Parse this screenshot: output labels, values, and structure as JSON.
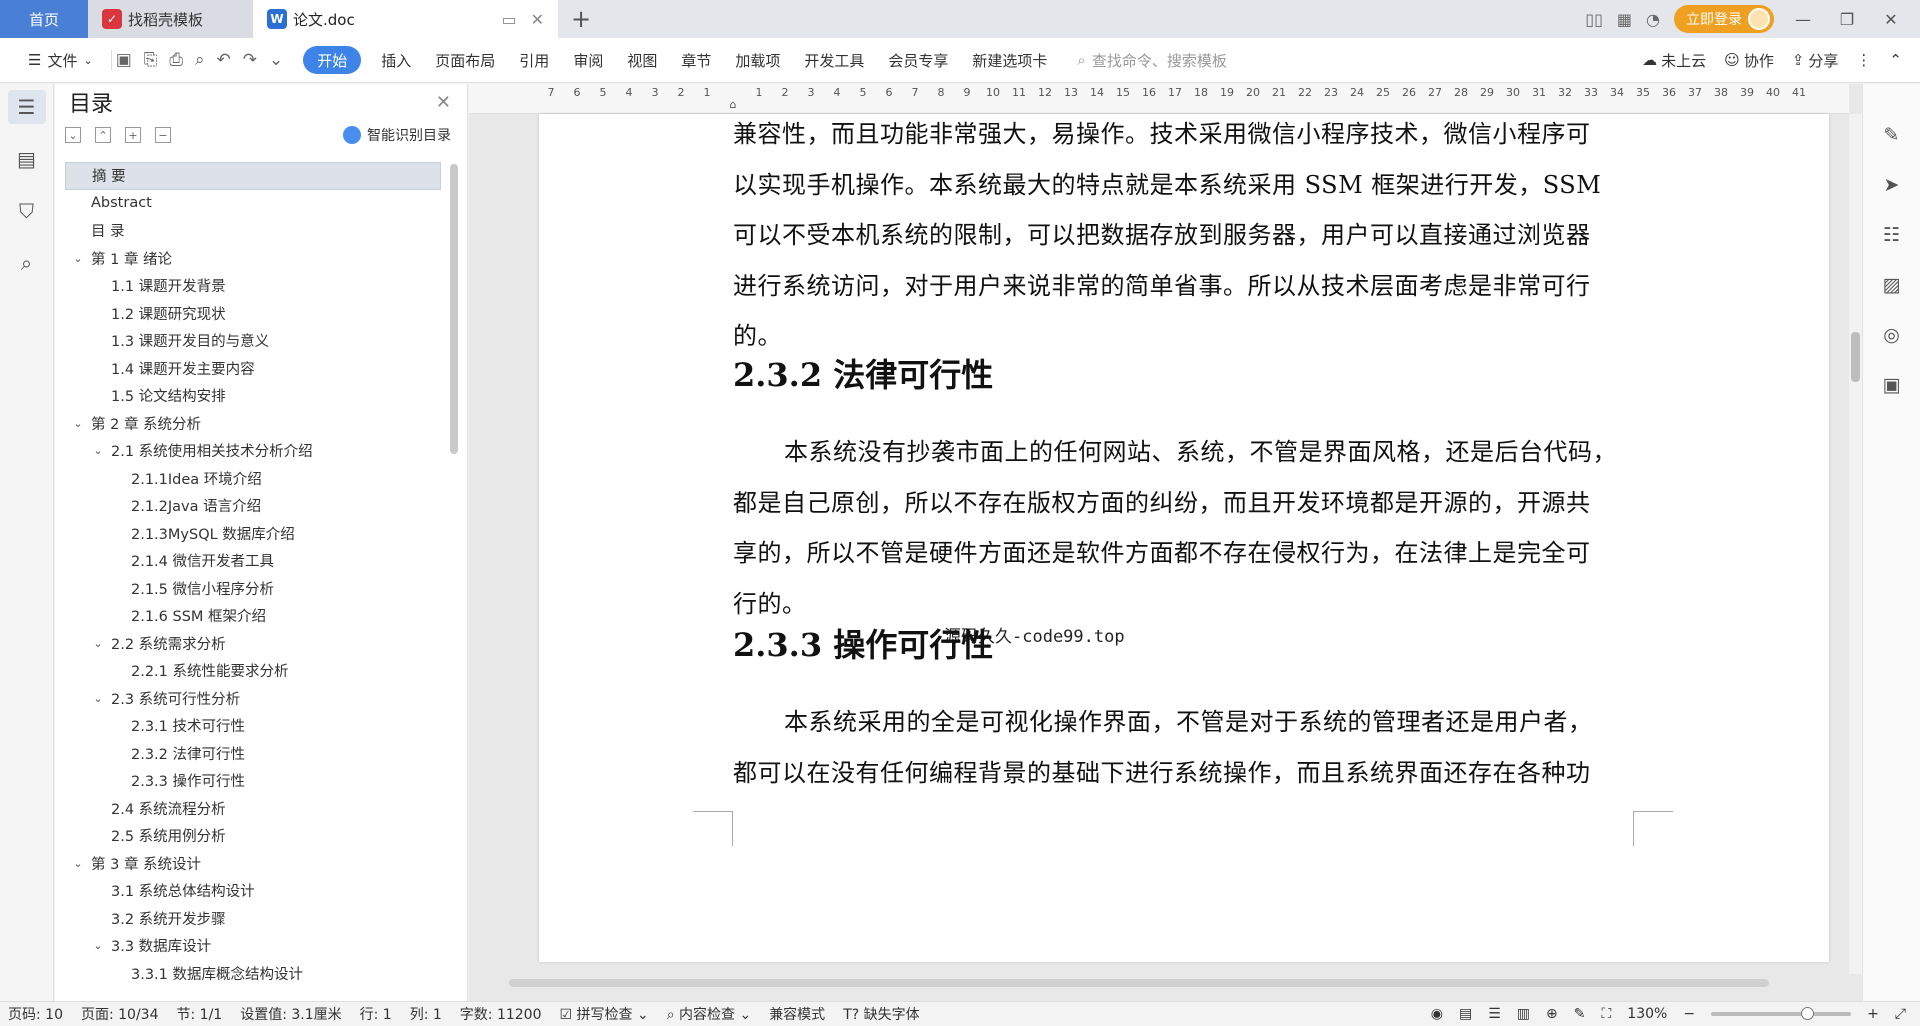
{
  "titlebar": {
    "home_tab": "首页",
    "template_tab": "找稻壳模板",
    "doc_tab": "论文.doc",
    "login": "立即登录"
  },
  "toolbar": {
    "file": "文件",
    "menus": [
      "开始",
      "插入",
      "页面布局",
      "引用",
      "审阅",
      "视图",
      "章节",
      "加载项",
      "开发工具",
      "会员专享",
      "新建选项卡"
    ],
    "search_placeholder": "查找命令、搜索模板",
    "cloud": "未上云",
    "collab": "协作",
    "share": "分享"
  },
  "toc": {
    "title": "目录",
    "smart": "智能识别目录",
    "items": [
      {
        "text": "摘  要",
        "level": 0,
        "selected": true
      },
      {
        "text": "Abstract",
        "level": 0
      },
      {
        "text": "目  录",
        "level": 0
      },
      {
        "text": "第 1 章   绪论",
        "level": 0,
        "collapsible": true
      },
      {
        "text": "1.1 课题开发背景",
        "level": 1
      },
      {
        "text": "1.2 课题研究现状",
        "level": 1
      },
      {
        "text": "1.3 课题开发目的与意义",
        "level": 1
      },
      {
        "text": "1.4 课题开发主要内容",
        "level": 1
      },
      {
        "text": "1.5 论文结构安排",
        "level": 1
      },
      {
        "text": "第 2 章  系统分析",
        "level": 0,
        "collapsible": true
      },
      {
        "text": "2.1 系统使用相关技术分析介绍",
        "level": 1,
        "collapsible": true
      },
      {
        "text": "2.1.1Idea 环境介绍",
        "level": 2
      },
      {
        "text": "2.1.2Java 语言介绍",
        "level": 2
      },
      {
        "text": "2.1.3MySQL 数据库介绍",
        "level": 2
      },
      {
        "text": "2.1.4 微信开发者工具",
        "level": 2
      },
      {
        "text": "2.1.5 微信小程序分析",
        "level": 2
      },
      {
        "text": "2.1.6 SSM 框架介绍",
        "level": 2
      },
      {
        "text": "2.2 系统需求分析",
        "level": 1,
        "collapsible": true
      },
      {
        "text": "2.2.1 系统性能要求分析",
        "level": 2
      },
      {
        "text": "2.3 系统可行性分析",
        "level": 1,
        "collapsible": true
      },
      {
        "text": "2.3.1 技术可行性",
        "level": 2
      },
      {
        "text": "2.3.2 法律可行性",
        "level": 2
      },
      {
        "text": "2.3.3 操作可行性",
        "level": 2
      },
      {
        "text": "2.4 系统流程分析",
        "level": 1
      },
      {
        "text": "2.5 系统用例分析",
        "level": 1
      },
      {
        "text": "第 3 章  系统设计",
        "level": 0,
        "collapsible": true
      },
      {
        "text": "3.1 系统总体结构设计",
        "level": 1
      },
      {
        "text": "3.2 系统开发步骤",
        "level": 1
      },
      {
        "text": "3.3 数据库设计",
        "level": 1,
        "collapsible": true
      },
      {
        "text": "3.3.1 数据库概念结构设计",
        "level": 2
      }
    ]
  },
  "ruler": {
    "left_numbers": [
      "7",
      "6",
      "5",
      "4",
      "3",
      "2",
      "1"
    ],
    "right_numbers": [
      "1",
      "2",
      "3",
      "4",
      "5",
      "6",
      "7",
      "8",
      "9",
      "10",
      "11",
      "12",
      "13",
      "14",
      "15",
      "16",
      "17",
      "18",
      "19",
      "20",
      "21",
      "22",
      "23",
      "24",
      "25",
      "26",
      "27",
      "28",
      "29",
      "30",
      "31",
      "32",
      "33",
      "34",
      "35",
      "36",
      "37",
      "38",
      "39",
      "40",
      "41"
    ]
  },
  "document": {
    "para1": [
      "兼容性，而且功能非常强大，易操作。技术采用微信小程序技术，微信小程序可",
      "以实现手机操作。本系统最大的特点就是本系统采用 SSM 框架进行开发，SSM",
      "可以不受本机系统的限制，可以把数据存放到服务器，用户可以直接通过浏览器",
      "进行系统访问，对于用户来说非常的简单省事。所以从技术层面考虑是非常可行",
      "的。"
    ],
    "heading1": "2.3.2 法律可行性",
    "para2": [
      "本系统没有抄袭市面上的任何网站、系统，不管是界面风格，还是后台代码，",
      "都是自己原创，所以不存在版权方面的纠纷，而且开发环境都是开源的，开源共",
      "享的，所以不管是硬件方面还是软件方面都不存在侵权行为，在法律上是完全可",
      "行的。"
    ],
    "watermark": "源码久久-code99.top",
    "heading2": "2.3.3 操作可行性",
    "para3": [
      "本系统采用的全是可视化操作界面，不管是对于系统的管理者还是用户者，",
      "都可以在没有任何编程背景的基础下进行系统操作，而且系统界面还存在各种功"
    ]
  },
  "status": {
    "page_code": "页码: 10",
    "page": "页面: 10/34",
    "section": "节: 1/1",
    "setting": "设置值: 3.1厘米",
    "row": "行: 1",
    "col": "列: 1",
    "words": "字数: 11200",
    "spell": "拼写检查",
    "content": "内容检查",
    "compat": "兼容模式",
    "missing_font": "缺失字体",
    "zoom": "130%"
  }
}
